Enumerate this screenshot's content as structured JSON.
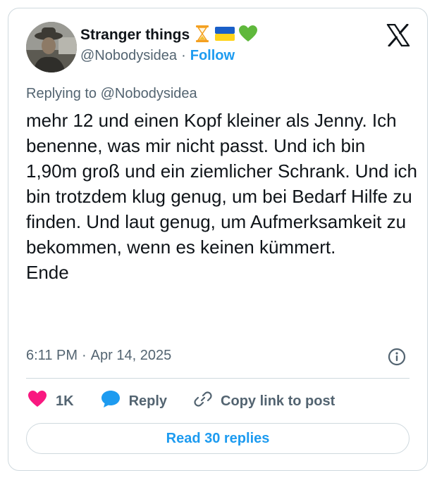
{
  "author": {
    "display_name": "Stranger things",
    "handle": "@Nobodysidea",
    "separator": "·",
    "follow_label": "Follow",
    "badges": [
      "hourglass-emoji",
      "ukraine-flag-emoji",
      "green-heart-emoji"
    ]
  },
  "tweet": {
    "replying_prefix": "Replying to",
    "replying_to": "@Nobodysidea",
    "text": "mehr 12 und einen Kopf kleiner als Jenny. Ich benenne, was mir nicht passt. Und ich bin 1,90m groß und ein ziemlicher Schrank. Und ich bin trotzdem klug genug, um bei Bedarf Hilfe zu finden. Und laut genug, um Aufmerksamkeit zu bekommen, wenn es keinen kümmert.\nEnde",
    "time": "6:11 PM",
    "separator": "·",
    "date": "Apr 14, 2025"
  },
  "actions": {
    "likes_count": "1K",
    "reply_label": "Reply",
    "copy_link_label": "Copy link to post"
  },
  "read_replies_label": "Read 30 replies",
  "colors": {
    "accent": "#1d9bf0",
    "like": "#f91880",
    "secondary_text": "#536471",
    "border": "#cfd9de"
  }
}
